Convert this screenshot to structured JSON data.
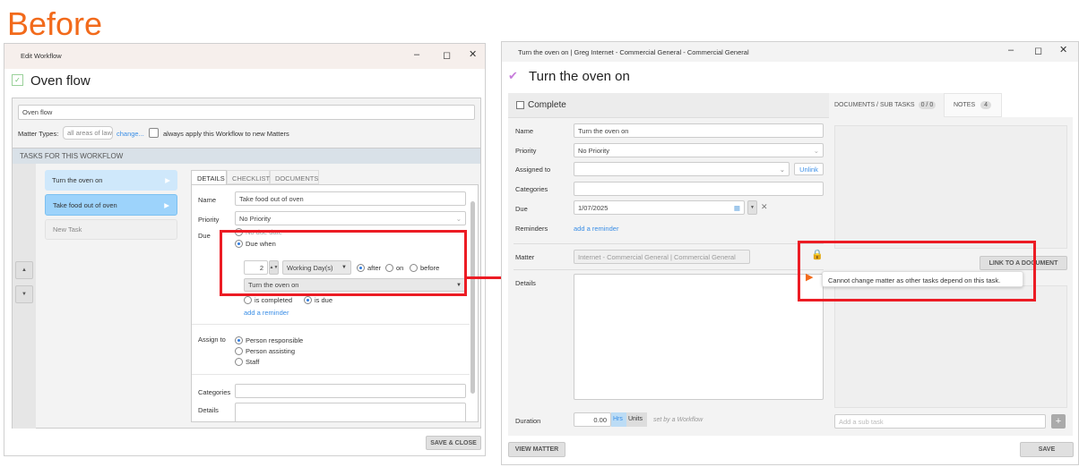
{
  "annotation": {
    "label": "Before",
    "color": "#f26a1b",
    "highlight_color": "#ec1c24"
  },
  "left": {
    "window_title": "Edit Workflow",
    "heading": "Oven flow",
    "name_value": "Oven flow",
    "matter_types_label": "Matter Types:",
    "matter_types_value": "all areas of law",
    "change_link": "change...",
    "always_apply_label": "always apply this Workflow to new Matters",
    "always_apply_checked": false,
    "tasks_header": "TASKS FOR THIS WORKFLOW",
    "tasks": [
      {
        "label": "Turn the oven on"
      },
      {
        "label": "Take food out of oven",
        "selected": true
      },
      {
        "label": "New Task"
      }
    ],
    "tabs": [
      "DETAILS",
      "CHECKLIST",
      "DOCUMENTS"
    ],
    "details": {
      "name_label": "Name",
      "name_value": "Take food out of oven",
      "priority_label": "Priority",
      "priority_value": "No Priority",
      "due_label": "Due",
      "no_due_date": "No due date",
      "due_when": "Due when",
      "offset_value": "2",
      "unit_value": "Working Day(s)",
      "after": "after",
      "on": "on",
      "before": "before",
      "dependency_value": "Turn the oven on",
      "is_completed": "is completed",
      "is_due": "is due",
      "add_reminder": "add a reminder",
      "assign_label": "Assign to",
      "assign_options": [
        "Person responsible",
        "Person assisting",
        "Staff"
      ],
      "categories_label": "Categories",
      "details_label": "Details"
    },
    "save_close": "SAVE & CLOSE"
  },
  "right": {
    "window_title": "Turn the oven on | Greg Internet - Commercial General - Commercial General",
    "heading": "Turn the oven on",
    "complete_label": "Complete",
    "name_label": "Name",
    "name_value": "Turn the oven on",
    "priority_label": "Priority",
    "priority_value": "No Priority",
    "assigned_label": "Assigned to",
    "unlink": "Unlink",
    "categories_label": "Categories",
    "due_label": "Due",
    "due_value": "1/07/2025",
    "reminders_label": "Reminders",
    "add_reminder": "add a reminder",
    "matter_label": "Matter",
    "matter_value": "Internet - Commercial General | Commercial General",
    "details_label": "Details",
    "duration_label": "Duration",
    "duration_value": "0.00",
    "hrs": "Hrs",
    "units": "Units",
    "set_by": "set by a Workflow",
    "tab_docs": "DOCUMENTS / SUB TASKS",
    "tab_docs_badge": "0 / 0",
    "tab_notes": "NOTES",
    "tab_notes_badge": "4",
    "link_document": "LINK TO A DOCUMENT",
    "tooltip": "Cannot change matter as other tasks depend on this task.",
    "subtask_placeholder": "Add a sub task",
    "view_matter": "VIEW MATTER",
    "save": "SAVE"
  }
}
